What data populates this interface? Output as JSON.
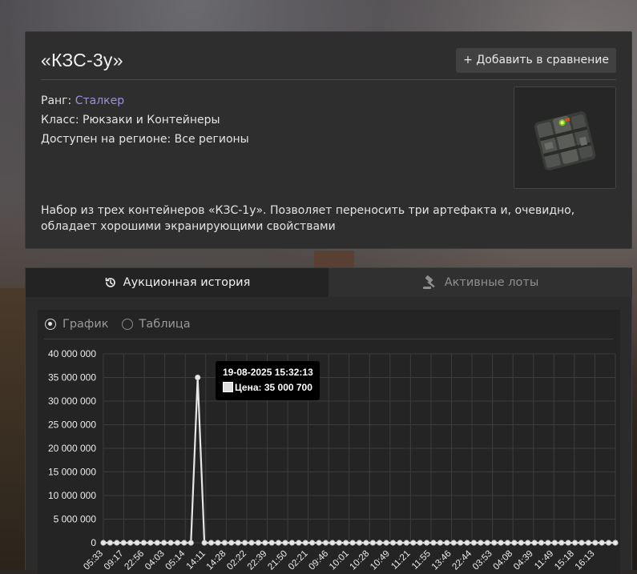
{
  "item": {
    "title": "«КЗС-3у»",
    "compare_button": "+ Добавить в сравнение",
    "rank_label": "Ранг:",
    "rank_value": "Сталкер",
    "class_text": "Класс: Рюкзаки и Контейнеры",
    "region_text": "Доступен на регионе: Все регионы",
    "description": "Набор из трех контейнеров «КЗС-1у». Позволяет переносить три артефакта и, очевидно, обладает хорошими экранирующими свойствами"
  },
  "tabs": {
    "history_label": "Аукционная история",
    "lots_label": "Активные лоты"
  },
  "view_toggle": {
    "chart_label": "График",
    "table_label": "Таблица",
    "selected": "chart"
  },
  "tooltip": {
    "date": "19-08-2025 15:32:13",
    "price_text": "Цена: 35 000 700"
  },
  "colors": {
    "rank": "#9d8fdc",
    "line": "#e6e6e6",
    "grid": "#3d3d3d"
  },
  "chart_data": {
    "type": "line",
    "ylim": [
      0,
      40000000
    ],
    "y_ticks": [
      "0",
      "5 000 000",
      "10 000 000",
      "15 000 000",
      "20 000 000",
      "25 000 000",
      "30 000 000",
      "35 000 000",
      "40 000 000"
    ],
    "x_tick_labels": [
      "05:33",
      "09:17",
      "22:56",
      "04:03",
      "05:14",
      "14:11",
      "14:28",
      "02:22",
      "22:39",
      "21:50",
      "02:21",
      "09:46",
      "10:01",
      "10:28",
      "10:49",
      "11:21",
      "11:55",
      "13:46",
      "22:44",
      "03:53",
      "04:08",
      "04:39",
      "11:49",
      "15:18",
      "16:13"
    ],
    "series": [
      {
        "values": [
          0,
          0,
          0,
          0,
          0,
          0,
          0,
          0,
          0,
          0,
          0,
          0,
          0,
          0,
          35000700,
          0,
          0,
          0,
          0,
          0,
          0,
          0,
          0,
          0,
          0,
          0,
          0,
          0,
          0,
          0,
          0,
          0,
          0,
          0,
          0,
          0,
          0,
          0,
          0,
          0,
          0,
          0,
          0,
          0,
          0,
          0,
          0,
          0,
          0,
          0,
          0,
          0,
          0,
          0,
          0,
          0,
          0,
          0,
          0,
          0,
          0,
          0,
          0,
          0,
          0,
          0,
          0,
          0,
          0,
          0,
          0,
          0,
          0,
          0,
          0,
          0,
          0
        ]
      }
    ],
    "highlight_index": 14
  }
}
